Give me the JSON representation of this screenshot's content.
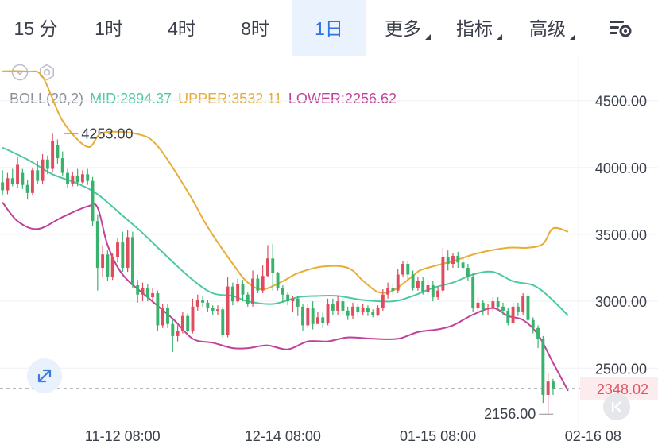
{
  "tabs": [
    {
      "label": "15 分",
      "active": false,
      "dropdown": false
    },
    {
      "label": "1时",
      "active": false,
      "dropdown": false
    },
    {
      "label": "4时",
      "active": false,
      "dropdown": false
    },
    {
      "label": "8时",
      "active": false,
      "dropdown": false
    },
    {
      "label": "1日",
      "active": true,
      "dropdown": false
    },
    {
      "label": "更多",
      "active": false,
      "dropdown": true
    },
    {
      "label": "指标",
      "active": false,
      "dropdown": true
    },
    {
      "label": "高级",
      "active": false,
      "dropdown": true
    }
  ],
  "icons": {
    "settings": "chart-settings-icon",
    "collapse": "chevron-down-circle-icon",
    "gear": "gear-icon",
    "expand": "expand-arrows-icon",
    "back": "skip-back-icon"
  },
  "indicator": {
    "name": "BOLL(20,2)",
    "mid": "MID:2894.37",
    "upper": "UPPER:3532.11",
    "lower": "LOWER:2256.62"
  },
  "colors": {
    "up": "#e04c5f",
    "down": "#38b36c",
    "mid": "#4cc9a4",
    "upper": "#e8ad35",
    "lower": "#c2409a",
    "accent": "#2f74e3",
    "price_label": "#e05563"
  },
  "chart_data": {
    "type": "candlestick",
    "y_axis_ticks": [
      "4500.00",
      "4000.00",
      "3500.00",
      "3000.00",
      "2500.00"
    ],
    "y_tick_values": [
      4500,
      4000,
      3500,
      3000,
      2500
    ],
    "x_axis_ticks": [
      "11-12 08:00",
      "12-14 08:00",
      "01-15 08:00",
      "02-16 08"
    ],
    "x_tick_index": [
      24,
      56,
      87,
      118
    ],
    "ylim": [
      2068,
      4825
    ],
    "last_price": "2348.02",
    "last_price_value": 2348.02,
    "max_marker": "4253.00",
    "max_marker_value": 4253,
    "max_marker_index": 11,
    "min_marker": "2156.00",
    "min_marker_value": 2156,
    "min_marker_index": 111,
    "visible_index_range": [
      0,
      113
    ],
    "upper": [
      [
        0,
        4720
      ],
      [
        5,
        4718
      ],
      [
        8,
        4680
      ],
      [
        12,
        4350
      ],
      [
        17,
        4155
      ],
      [
        20,
        4260
      ],
      [
        27,
        4250
      ],
      [
        31,
        4160
      ],
      [
        37,
        3820
      ],
      [
        41,
        3555
      ],
      [
        46,
        3280
      ],
      [
        49,
        3140
      ],
      [
        52,
        3090
      ],
      [
        56,
        3150
      ],
      [
        59,
        3210
      ],
      [
        64,
        3260
      ],
      [
        69,
        3250
      ],
      [
        72,
        3155
      ],
      [
        75,
        3070
      ],
      [
        78,
        3080
      ],
      [
        82,
        3190
      ],
      [
        84,
        3240
      ],
      [
        90,
        3300
      ],
      [
        95,
        3360
      ],
      [
        101,
        3400
      ],
      [
        105,
        3400
      ],
      [
        108,
        3430
      ],
      [
        110,
        3545
      ],
      [
        113,
        3520
      ]
    ],
    "mid": [
      [
        0,
        4150
      ],
      [
        5,
        4060
      ],
      [
        10,
        3950
      ],
      [
        15,
        3880
      ],
      [
        19,
        3800
      ],
      [
        24,
        3640
      ],
      [
        28,
        3510
      ],
      [
        33,
        3330
      ],
      [
        38,
        3160
      ],
      [
        42,
        3060
      ],
      [
        46,
        3040
      ],
      [
        49,
        3000
      ],
      [
        54,
        2980
      ],
      [
        59,
        3030
      ],
      [
        63,
        3040
      ],
      [
        67,
        3040
      ],
      [
        72,
        3010
      ],
      [
        78,
        3000
      ],
      [
        82,
        3040
      ],
      [
        86,
        3100
      ],
      [
        90,
        3140
      ],
      [
        94,
        3200
      ],
      [
        98,
        3220
      ],
      [
        102,
        3150
      ],
      [
        106,
        3120
      ],
      [
        109,
        3040
      ],
      [
        113,
        2894
      ]
    ],
    "lower": [
      [
        0,
        3740
      ],
      [
        3,
        3600
      ],
      [
        7,
        3540
      ],
      [
        12,
        3630
      ],
      [
        17,
        3710
      ],
      [
        19,
        3700
      ],
      [
        21,
        3420
      ],
      [
        24,
        3200
      ],
      [
        29,
        3030
      ],
      [
        34,
        2870
      ],
      [
        38,
        2720
      ],
      [
        42,
        2690
      ],
      [
        46,
        2650
      ],
      [
        49,
        2650
      ],
      [
        53,
        2670
      ],
      [
        57,
        2640
      ],
      [
        61,
        2700
      ],
      [
        65,
        2700
      ],
      [
        69,
        2730
      ],
      [
        74,
        2720
      ],
      [
        79,
        2720
      ],
      [
        83,
        2770
      ],
      [
        87,
        2790
      ],
      [
        90,
        2820
      ],
      [
        94,
        2900
      ],
      [
        98,
        2950
      ],
      [
        101,
        2890
      ],
      [
        104,
        2860
      ],
      [
        107,
        2750
      ],
      [
        110,
        2540
      ],
      [
        113,
        2330
      ]
    ],
    "candles": [
      [
        3890,
        3830,
        3980,
        3790
      ],
      [
        3830,
        3920,
        3960,
        3800
      ],
      [
        3920,
        3880,
        3990,
        3860
      ],
      [
        3880,
        4020,
        4080,
        3850
      ],
      [
        3960,
        3870,
        3990,
        3840
      ],
      [
        3870,
        3810,
        3910,
        3760
      ],
      [
        3810,
        3980,
        4000,
        3790
      ],
      [
        3980,
        3900,
        4050,
        3880
      ],
      [
        3900,
        4060,
        4100,
        3880
      ],
      [
        4060,
        3990,
        4090,
        3950
      ],
      [
        3990,
        4200,
        4253,
        3970
      ],
      [
        4170,
        4070,
        4210,
        4030
      ],
      [
        4070,
        3960,
        4120,
        3940
      ],
      [
        3960,
        3880,
        3990,
        3850
      ],
      [
        3880,
        3940,
        3970,
        3860
      ],
      [
        3940,
        3890,
        3990,
        3860
      ],
      [
        3890,
        3950,
        3980,
        3880
      ],
      [
        3950,
        3900,
        3990,
        3870
      ],
      [
        3900,
        3600,
        3930,
        3560
      ],
      [
        3600,
        3250,
        3650,
        3080
      ],
      [
        3250,
        3350,
        3420,
        3180
      ],
      [
        3350,
        3180,
        3380,
        3150
      ],
      [
        3180,
        3330,
        3360,
        3160
      ],
      [
        3330,
        3440,
        3470,
        3290
      ],
      [
        3440,
        3250,
        3520,
        3220
      ],
      [
        3250,
        3480,
        3530,
        3220
      ],
      [
        3480,
        3120,
        3520,
        3100
      ],
      [
        3120,
        3050,
        3160,
        2990
      ],
      [
        3050,
        3100,
        3140,
        3000
      ],
      [
        3100,
        3030,
        3130,
        3000
      ],
      [
        3030,
        3060,
        3100,
        2990
      ],
      [
        3060,
        2820,
        3080,
        2780
      ],
      [
        2820,
        2950,
        2980,
        2800
      ],
      [
        2950,
        2830,
        2980,
        2800
      ],
      [
        2830,
        2740,
        2860,
        2620
      ],
      [
        2740,
        2780,
        2820,
        2700
      ],
      [
        2780,
        2890,
        2920,
        2760
      ],
      [
        2890,
        2780,
        2910,
        2750
      ],
      [
        2780,
        2960,
        3020,
        2760
      ],
      [
        2960,
        3010,
        3050,
        2930
      ],
      [
        3010,
        2990,
        3040,
        2960
      ],
      [
        2990,
        2950,
        3010,
        2920
      ],
      [
        2950,
        2930,
        2970,
        2900
      ],
      [
        2930,
        2940,
        2970,
        2900
      ],
      [
        2940,
        2750,
        2960,
        2730
      ],
      [
        2750,
        3110,
        3180,
        2730
      ],
      [
        3110,
        3000,
        3140,
        2970
      ],
      [
        3000,
        3130,
        3170,
        2990
      ],
      [
        3130,
        3050,
        3160,
        3000
      ],
      [
        3050,
        2980,
        3070,
        2960
      ],
      [
        2980,
        3170,
        3230,
        2960
      ],
      [
        3170,
        3080,
        3200,
        3060
      ],
      [
        3080,
        3190,
        3270,
        3060
      ],
      [
        3190,
        3320,
        3420,
        3180
      ],
      [
        3320,
        3210,
        3430,
        3080
      ],
      [
        3210,
        3100,
        3220,
        3080
      ],
      [
        3100,
        3050,
        3120,
        2990
      ],
      [
        3050,
        3000,
        3070,
        2970
      ],
      [
        3000,
        3020,
        3040,
        2920
      ],
      [
        3020,
        2960,
        3040,
        2890
      ],
      [
        2960,
        2820,
        2980,
        2780
      ],
      [
        2820,
        2950,
        2980,
        2800
      ],
      [
        2950,
        2830,
        3000,
        2790
      ],
      [
        2830,
        2880,
        2920,
        2840
      ],
      [
        2880,
        2840,
        2920,
        2800
      ],
      [
        2840,
        2980,
        3020,
        2820
      ],
      [
        2980,
        2930,
        3020,
        2900
      ],
      [
        2930,
        3000,
        3040,
        2900
      ],
      [
        3000,
        2930,
        3030,
        2900
      ],
      [
        2930,
        2890,
        2960,
        2860
      ],
      [
        2890,
        2960,
        2990,
        2870
      ],
      [
        2960,
        2920,
        2980,
        2890
      ],
      [
        2920,
        2950,
        2980,
        2900
      ],
      [
        2950,
        2920,
        2970,
        2890
      ],
      [
        2920,
        2900,
        2940,
        2880
      ],
      [
        2900,
        2950,
        2970,
        2890
      ],
      [
        2950,
        3050,
        3090,
        2930
      ],
      [
        3050,
        3100,
        3140,
        3020
      ],
      [
        3100,
        3080,
        3130,
        3050
      ],
      [
        3080,
        3200,
        3240,
        3060
      ],
      [
        3200,
        3280,
        3300,
        3180
      ],
      [
        3280,
        3200,
        3300,
        3150
      ],
      [
        3200,
        3100,
        3230,
        3080
      ],
      [
        3100,
        3150,
        3180,
        3080
      ],
      [
        3150,
        3070,
        3180,
        3050
      ],
      [
        3070,
        3120,
        3160,
        3050
      ],
      [
        3120,
        3030,
        3150,
        3000
      ],
      [
        3030,
        3080,
        3110,
        3010
      ],
      [
        3080,
        3330,
        3400,
        3060
      ],
      [
        3330,
        3280,
        3380,
        3230
      ],
      [
        3280,
        3340,
        3360,
        3250
      ],
      [
        3340,
        3290,
        3370,
        3250
      ],
      [
        3290,
        3250,
        3330,
        3230
      ],
      [
        3250,
        3180,
        3280,
        3150
      ],
      [
        3180,
        2950,
        3210,
        2920
      ],
      [
        2950,
        2990,
        3030,
        2920
      ],
      [
        2990,
        2940,
        3010,
        2900
      ],
      [
        2940,
        2950,
        2980,
        2900
      ],
      [
        2950,
        3000,
        3030,
        2920
      ],
      [
        3000,
        2960,
        3030,
        2930
      ],
      [
        2960,
        2930,
        2990,
        2900
      ],
      [
        2930,
        2840,
        2950,
        2820
      ],
      [
        2840,
        2960,
        2990,
        2830
      ],
      [
        2960,
        2920,
        2990,
        2890
      ],
      [
        2920,
        3040,
        3060,
        2900
      ],
      [
        3040,
        2860,
        3060,
        2830
      ],
      [
        2860,
        2800,
        2880,
        2760
      ],
      [
        2800,
        2720,
        2820,
        2650
      ],
      [
        2720,
        2300,
        2740,
        2240
      ],
      [
        2300,
        2400,
        2460,
        2156
      ],
      [
        2400,
        2348,
        2420,
        2300
      ]
    ]
  }
}
